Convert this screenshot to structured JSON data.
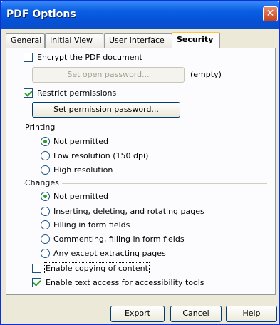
{
  "window": {
    "title": "PDF Options",
    "close_symbol": "✕"
  },
  "tabs": [
    {
      "label": "General"
    },
    {
      "label": "Initial View"
    },
    {
      "label": "User Interface"
    },
    {
      "label": "Security"
    }
  ],
  "security": {
    "encrypt_label": "Encrypt the PDF document",
    "encrypt_checked": false,
    "set_open_password_button": "Set open password...",
    "open_password_state": "(empty)",
    "restrict_label": "Restrict permissions",
    "restrict_checked": true,
    "set_permission_password_button": "Set permission password...",
    "printing": {
      "label": "Printing",
      "options": [
        "Not permitted",
        "Low resolution (150 dpi)",
        "High resolution"
      ],
      "selected": "Not permitted"
    },
    "changes": {
      "label": "Changes",
      "options": [
        "Not permitted",
        "Inserting, deleting, and rotating pages",
        "Filling in form fields",
        "Commenting, filling in form fields",
        "Any except extracting pages"
      ],
      "selected": "Not permitted"
    },
    "copy_label": "Enable copying of content",
    "copy_checked": false,
    "accessibility_label": "Enable text access for accessibility tools",
    "accessibility_checked": true
  },
  "footer": {
    "export": "Export",
    "cancel": "Cancel",
    "help": "Help"
  }
}
